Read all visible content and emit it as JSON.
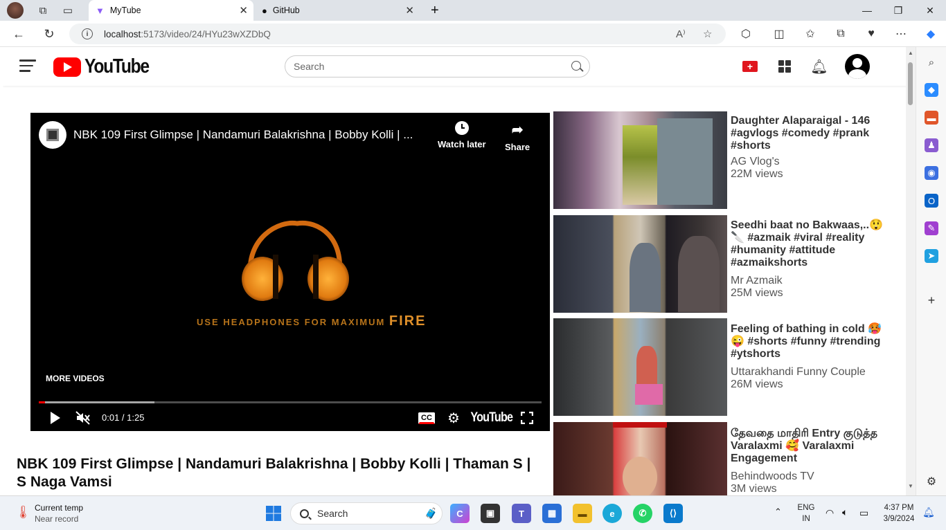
{
  "browser": {
    "tabs": [
      {
        "title": "MyTube",
        "active": true
      },
      {
        "title": "GitHub",
        "active": false
      }
    ],
    "url_host": "localhost",
    "url_path": ":5173/video/24/HYu23wXZDbQ",
    "new_tab": "+",
    "win_min": "—",
    "win_max": "❐",
    "win_close": "✕"
  },
  "header": {
    "logo_text": "YouTube",
    "search_placeholder": "Search"
  },
  "player": {
    "title": "NBK 109 First Glimpse | Nandamuri Balakrishna | Bobby Kolli | ...",
    "watch_later": "Watch later",
    "share": "Share",
    "more_videos": "MORE VIDEOS",
    "time": "0:01 / 1:25",
    "progress_played": 0.013,
    "progress_buffered": 0.23,
    "cc": "CC",
    "brand": "YouTube",
    "art_text_main": "USE HEADPHONES FOR MAXIMUM ",
    "art_text_strong": "FIRE"
  },
  "video": {
    "title": "NBK 109 First Glimpse | Nandamuri Balakrishna | Bobby Kolli | Thaman S | S Naga Vamsi"
  },
  "recommendations": [
    {
      "title": "Daughter Alaparaigal - 146 #agvlogs #comedy #prank #shorts",
      "channel": "AG Vlog's",
      "views": "22M views"
    },
    {
      "title": "Seedhi baat no Bakwaas,..😲 🔪 #azmaik #viral #reality #humanity #attitude #azmaikshorts",
      "channel": "Mr Azmaik",
      "views": "25M views"
    },
    {
      "title": "Feeling of bathing in cold 🥵 😜 #shorts #funny #trending #ytshorts",
      "channel": "Uttarakhandi Funny Couple",
      "views": "26M views"
    },
    {
      "title": "தேவதை மாதிரி Entry குடுத்த Varalaxmi 🥰 Varalaxmi Engagement",
      "channel": "Behindwoods TV",
      "views": "3M views"
    }
  ],
  "taskbar": {
    "weather_title": "Current temp",
    "weather_sub": "Near record",
    "search": "Search",
    "lang_1": "ENG",
    "lang_2": "IN",
    "time": "4:37 PM",
    "date": "3/9/2024"
  },
  "colors": {
    "yt_red": "#ff0000",
    "accent": "#e0161e",
    "tab_bar": "#dfe3e8",
    "taskbar": "#eef2f7"
  }
}
